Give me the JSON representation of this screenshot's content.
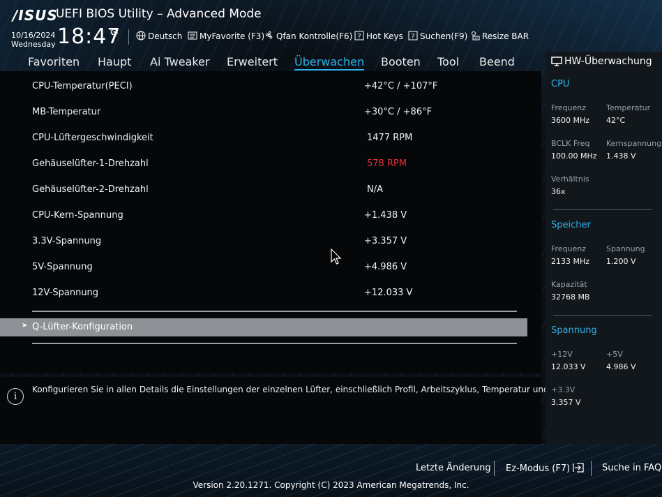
{
  "header": {
    "logo": "/ISUS",
    "title": "UEFI BIOS Utility – Advanced Mode",
    "date": "10/16/2024",
    "weekday": "Wednesday",
    "time": "18:47",
    "toolbar": {
      "language": "Deutsch",
      "myfavorite": "MyFavorite (F3)",
      "qfan": "Qfan Kontrolle(F6)",
      "hotkeys": "Hot Keys",
      "search": "Suchen(F9)",
      "resizebar": "Resize BAR"
    }
  },
  "tabs": [
    "Favoriten",
    "Haupt",
    "Ai Tweaker",
    "Erweitert",
    "Überwachen",
    "Booten",
    "Tool",
    "Beend"
  ],
  "active_tab": "Überwachen",
  "monitor": [
    {
      "label": "CPU-Temperatur(PECI)",
      "value": "+42°C / +107°F"
    },
    {
      "label": "MB-Temperatur",
      "value": "+30°C / +86°F"
    },
    {
      "label": "CPU-Lüftergeschwindigkeit",
      "value": "1477 RPM"
    },
    {
      "label": "Gehäuselüfter-1-Drehzahl",
      "value": "578 RPM"
    },
    {
      "label": "Gehäuselüfter-2-Drehzahl",
      "value": "N/A"
    },
    {
      "label": "CPU-Kern-Spannung",
      "value": "+1.438 V"
    },
    {
      "label": "3.3V-Spannung",
      "value": "+3.357 V"
    },
    {
      "label": "5V-Spannung",
      "value": "+4.986 V"
    },
    {
      "label": "12V-Spannung",
      "value": "+12.033 V"
    }
  ],
  "warning_color": "#e0303a",
  "accent_color": "#2fb1e8",
  "submenu": {
    "arrow": "➤",
    "label": "Q-Lüfter-Konfiguration"
  },
  "info": "Konfigurieren Sie in allen Details die Einstellungen der einzelnen Lüfter, einschließlich Profil, Arbeitszyklus, Temperatur und mehr.",
  "hw": {
    "title": "HW-Überwachung",
    "cpu": {
      "heading": "CPU",
      "freq_label": "Frequenz",
      "freq": "3600 MHz",
      "temp_label": "Temperatur",
      "temp": "42°C",
      "bclk_label": "BCLK Freq",
      "bclk": "100.00 MHz",
      "core_label": "Kernspannung",
      "core": "1.438 V",
      "ratio_label": "Verhältnis",
      "ratio": "36x"
    },
    "memory": {
      "heading": "Speicher",
      "freq_label": "Frequenz",
      "freq": "2133 MHz",
      "volt_label": "Spannung",
      "volt": "1.200 V",
      "cap_label": "Kapazität",
      "cap": "32768 MB"
    },
    "voltage": {
      "heading": "Spannung",
      "v12_label": "+12V",
      "v12": "12.033 V",
      "v5_label": "+5V",
      "v5": "4.986 V",
      "v33_label": "+3.3V",
      "v33": "3.357 V"
    }
  },
  "footer": {
    "last_change": "Letzte Änderung",
    "ez_mode": "Ez-Modus (F7)",
    "faq": "Suche in FAQ",
    "copyright": "Version 2.20.1271. Copyright (C) 2023 American Megatrends, Inc."
  }
}
